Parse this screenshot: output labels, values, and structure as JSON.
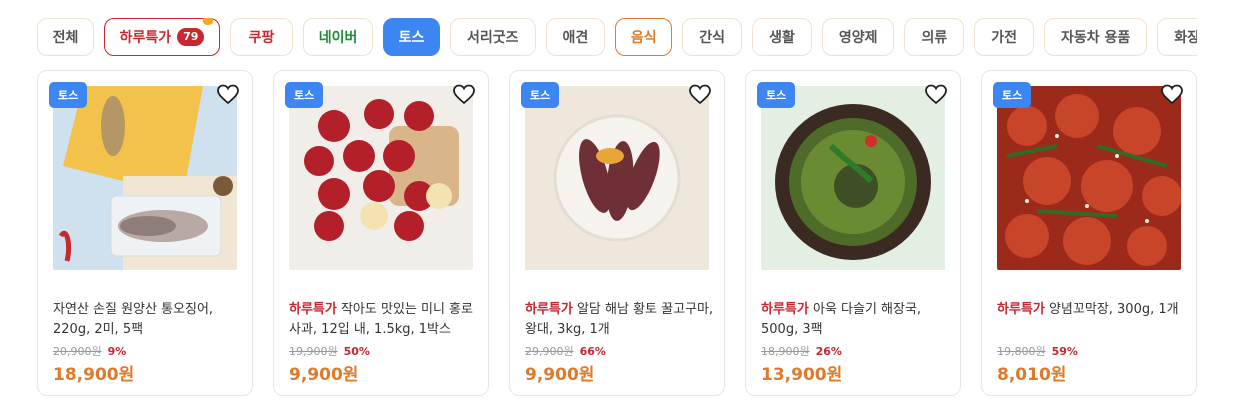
{
  "chips": [
    {
      "label": "전체"
    },
    {
      "label": "하루특가",
      "count": "79"
    },
    {
      "label": "쿠팡"
    },
    {
      "label": "네이버"
    },
    {
      "label": "토스"
    },
    {
      "label": "서리굿즈"
    },
    {
      "label": "애견"
    },
    {
      "label": "음식"
    },
    {
      "label": "간식"
    },
    {
      "label": "생활"
    },
    {
      "label": "영양제"
    },
    {
      "label": "의류"
    },
    {
      "label": "가전"
    },
    {
      "label": "자동차 용품"
    },
    {
      "label": "화장품"
    }
  ],
  "products": [
    {
      "tag": "토스",
      "highlight": "",
      "title": "자연산 손질 원양산 통오징어, 220g, 2미, 5팩",
      "orig": "20,900원",
      "discount": "9%",
      "price": "18,900원"
    },
    {
      "tag": "토스",
      "highlight": "하루특가",
      "title": " 작아도 맛있는 미니 홍로사과, 12입 내, 1.5kg, 1박스",
      "orig": "19,900원",
      "discount": "50%",
      "price": "9,900원"
    },
    {
      "tag": "토스",
      "highlight": "하루특가",
      "title": " 알담 해남 황토 꿀고구마, 왕대, 3kg, 1개",
      "orig": "29,900원",
      "discount": "66%",
      "price": "9,900원"
    },
    {
      "tag": "토스",
      "highlight": "하루특가",
      "title": " 아욱 다슬기 해장국, 500g, 3팩",
      "orig": "18,900원",
      "discount": "26%",
      "price": "13,900원"
    },
    {
      "tag": "토스",
      "highlight": "하루특가",
      "title": " 양념꼬막장, 300g, 1개",
      "orig": "19,800원",
      "discount": "59%",
      "price": "8,010원"
    }
  ]
}
